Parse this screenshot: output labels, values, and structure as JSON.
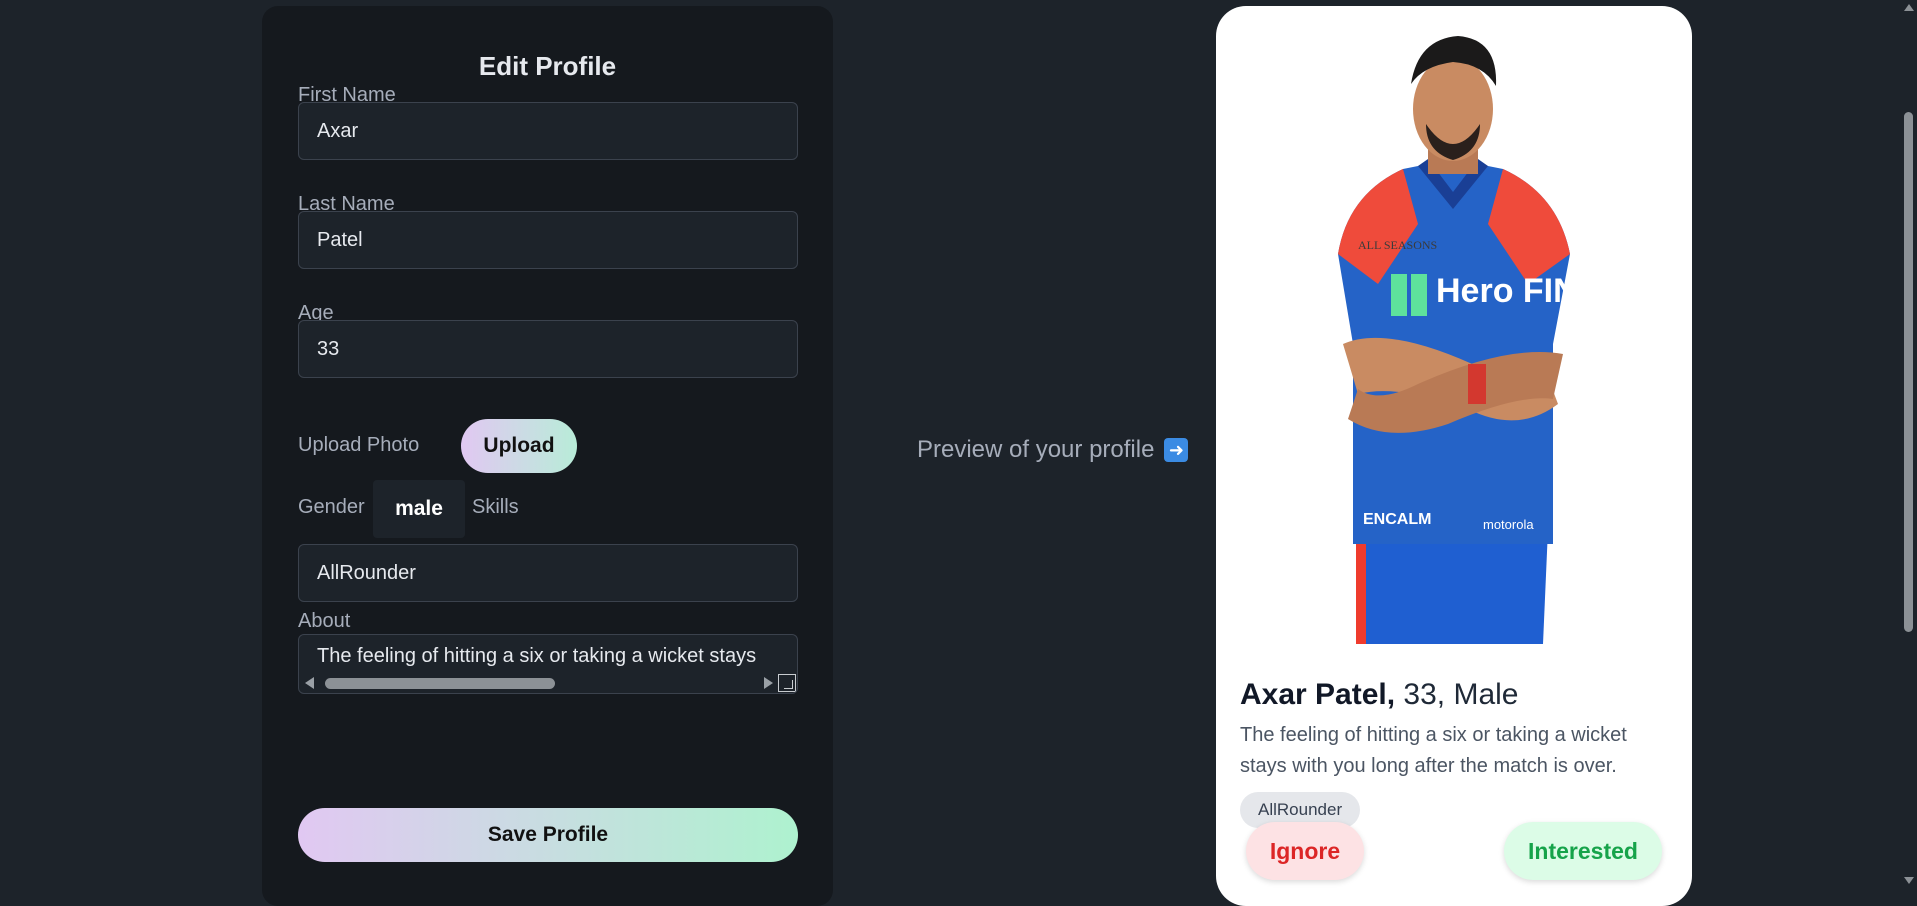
{
  "form": {
    "title": "Edit Profile",
    "first_name_label": "First Name",
    "first_name_value": "Axar",
    "last_name_label": "Last Name",
    "last_name_value": "Patel",
    "age_label": "Age",
    "age_value": "33",
    "upload_label": "Upload Photo",
    "upload_button": "Upload",
    "gender_label": "Gender",
    "gender_value": "male",
    "skills_label": "Skills",
    "skills_value": "AllRounder",
    "about_label": "About",
    "about_value": "The feeling of hitting a six or taking a wicket stays",
    "save_button": "Save Profile"
  },
  "preview": {
    "text": "Preview of your profile",
    "arrow_icon": "right-arrow-icon"
  },
  "profile_card": {
    "name": "Axar Patel,",
    "age_gender": " 33, Male",
    "about": "The feeling of hitting a six or taking a wicket stays with you long after the match is over.",
    "skill": "AllRounder",
    "ignore_button": "Ignore",
    "interested_button": "Interested",
    "photo_sponsor_text": "Hero FINCORP",
    "photo_badge_text": "ALL SEASONS",
    "photo_short_text": "ENCALM",
    "photo_brand_text": "motorola"
  },
  "colors": {
    "background": "#1d232a",
    "form_card": "#15191e",
    "ignore": "#dc2626",
    "interested": "#16a34a"
  }
}
